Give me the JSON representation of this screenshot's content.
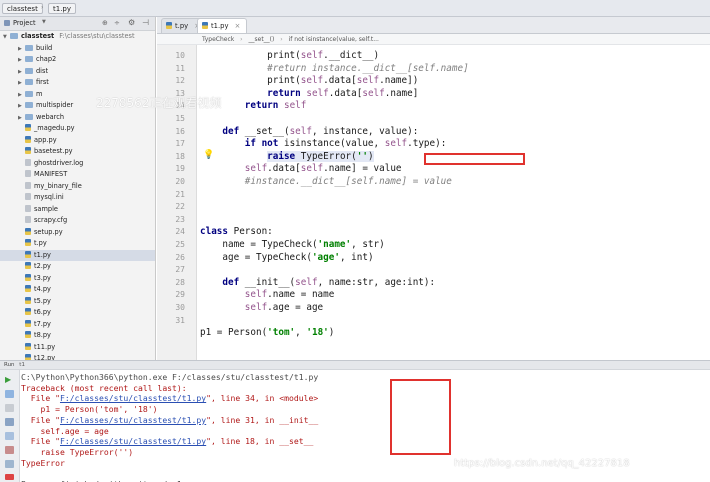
{
  "topbar": {
    "crumbs": [
      "classtest",
      "t1.py"
    ]
  },
  "project": {
    "header_label": "Project",
    "root_name": "classtest",
    "root_path": "F:\\classes\\stu\\classtest",
    "items": [
      {
        "label": "build",
        "type": "folder"
      },
      {
        "label": "chap2",
        "type": "folder"
      },
      {
        "label": "dist",
        "type": "folder"
      },
      {
        "label": "first",
        "type": "folder"
      },
      {
        "label": "m",
        "type": "folder"
      },
      {
        "label": "multispider",
        "type": "folder"
      },
      {
        "label": "webarch",
        "type": "folder"
      },
      {
        "label": "_magedu.py",
        "type": "py"
      },
      {
        "label": "app.py",
        "type": "py"
      },
      {
        "label": "basetest.py",
        "type": "py"
      },
      {
        "label": "ghostdriver.log",
        "type": "file"
      },
      {
        "label": "MANIFEST",
        "type": "file"
      },
      {
        "label": "my_binary_file",
        "type": "file"
      },
      {
        "label": "mysql.ini",
        "type": "file"
      },
      {
        "label": "sample",
        "type": "file"
      },
      {
        "label": "scrapy.cfg",
        "type": "file"
      },
      {
        "label": "setup.py",
        "type": "py"
      },
      {
        "label": "t.py",
        "type": "py"
      },
      {
        "label": "t1.py",
        "type": "py",
        "selected": true
      },
      {
        "label": "t2.py",
        "type": "py"
      },
      {
        "label": "t3.py",
        "type": "py"
      },
      {
        "label": "t4.py",
        "type": "py"
      },
      {
        "label": "t5.py",
        "type": "py"
      },
      {
        "label": "t6.py",
        "type": "py"
      },
      {
        "label": "t7.py",
        "type": "py"
      },
      {
        "label": "t8.py",
        "type": "py"
      },
      {
        "label": "t11.py",
        "type": "py"
      },
      {
        "label": "t12.py",
        "type": "py"
      }
    ]
  },
  "tabs": [
    {
      "label": "t.py",
      "active": false
    },
    {
      "label": "t1.py",
      "active": true
    }
  ],
  "editor_breadcrumb": [
    "TypeCheck",
    "__set__()",
    "if not isinstance(value, self.t..."
  ],
  "gutter_numbers": [
    "10",
    "11",
    "12",
    "13",
    "14",
    "15",
    "16",
    "17",
    "18",
    "19",
    "20",
    "21",
    "22",
    "23",
    "24",
    "25",
    "26",
    "27",
    "28",
    "29",
    "30",
    "31"
  ],
  "code_lines": [
    {
      "ln": "10",
      "html": "            print(<span class=\"slf\">self</span>.__dict__)"
    },
    {
      "ln": "11",
      "html": "            <span class=\"cm\">#return instance.__dict__[self.name]</span>"
    },
    {
      "ln": "12",
      "html": "            print(<span class=\"slf\">self</span>.data[<span class=\"slf\">self</span>.name])"
    },
    {
      "ln": "13",
      "html": "            <span class=\"kw\">return</span> <span class=\"slf\">self</span>.data[<span class=\"slf\">self</span>.name]"
    },
    {
      "ln": "14",
      "html": "        <span class=\"kw\">return</span> <span class=\"slf\">self</span>"
    },
    {
      "ln": "15",
      "html": ""
    },
    {
      "ln": "16",
      "html": "    <span class=\"kw\">def</span> __set__(<span class=\"slf\">self</span>, instance, value):"
    },
    {
      "ln": "17",
      "html": "        <span class=\"kw\">if not</span> isinstance(value, <span class=\"slf\">self</span>.type):"
    },
    {
      "ln": "18",
      "html": "            <span class=\"hl\"><span class=\"kw\">raise</span> TypeError(<span class=\"str\">''</span>)</span>"
    },
    {
      "ln": "19",
      "html": "        <span class=\"slf\">self</span>.data[<span class=\"slf\">self</span>.name] = value"
    },
    {
      "ln": "20",
      "html": "        <span class=\"cm\">#instance.__dict__[self.name] = value</span>"
    },
    {
      "ln": "21",
      "html": ""
    },
    {
      "ln": "22",
      "html": ""
    },
    {
      "ln": "23",
      "html": ""
    },
    {
      "ln": "24",
      "html": "<span class=\"kw\">class</span> Person:"
    },
    {
      "ln": "25",
      "html": "    name = TypeCheck(<span class=\"str\">'name'</span>, str)"
    },
    {
      "ln": "26",
      "html": "    age = TypeCheck(<span class=\"str\">'age'</span>, int)"
    },
    {
      "ln": "27",
      "html": ""
    },
    {
      "ln": "28",
      "html": "    <span class=\"kw\">def</span> __init__(<span class=\"slf\">self</span>, name:str, age:int):"
    },
    {
      "ln": "29",
      "html": "        <span class=\"slf\">self</span>.name = name"
    },
    {
      "ln": "30",
      "html": "        <span class=\"slf\">self</span>.age = age"
    },
    {
      "ln": "31",
      "html": ""
    },
    {
      "ln": "",
      "html": "p1 = Person(<span class=\"str\">'tom'</span>, <span class=\"str\">'18'</span>)"
    }
  ],
  "run_panel": {
    "title": "Run",
    "tab": "t1",
    "lines": [
      {
        "style": "gray",
        "html": "C:\\Python\\Python366\\python.exe F:/classes/stu/classtest/t1.py"
      },
      {
        "style": "red",
        "html": "Traceback (most recent call last):"
      },
      {
        "style": "red",
        "html": "  File \"<span class=\"link\">F:/classes/stu/classtest/t1.py</span>\", line 34, in &lt;module&gt;"
      },
      {
        "style": "red",
        "html": "    p1 = Person('tom', '18')"
      },
      {
        "style": "red",
        "html": "  File \"<span class=\"link\">F:/classes/stu/classtest/t1.py</span>\", line 31, in __init__"
      },
      {
        "style": "red",
        "html": "    self.age = age"
      },
      {
        "style": "red",
        "html": "  File \"<span class=\"link\">F:/classes/stu/classtest/t1.py</span>\", line 18, in __set__"
      },
      {
        "style": "red",
        "html": "    raise TypeError('')"
      },
      {
        "style": "red",
        "html": "TypeError"
      },
      {
        "style": "gray",
        "html": ""
      },
      {
        "style": "gray",
        "html": "Process finished with exit code 1"
      }
    ]
  },
  "watermarks": {
    "overlay": "2278562正在观看视频",
    "site": "https://blog.csdn.net/qq_42227818"
  },
  "colors": {
    "annotation_red": "#e0322e",
    "keyword": "#000080",
    "string": "#008000",
    "self": "#94558d"
  }
}
